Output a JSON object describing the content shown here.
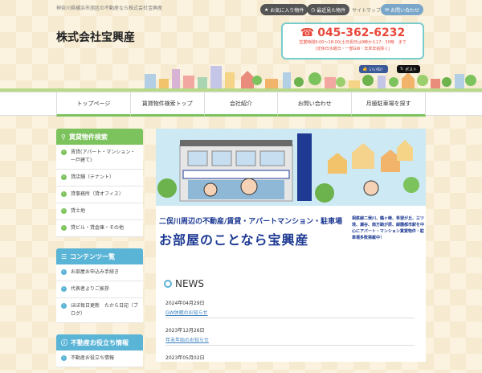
{
  "header": {
    "tagline": "神奈川県横浜市旭区の不動産なら株式会社宝興産",
    "favorites_label": "お気に入り物件",
    "recent_label": "最近見た物件",
    "sitemap_label": "サイトマップ",
    "contact_label": "お問い合わせ",
    "company_name": "株式会社宝興産",
    "phone": "045-362-6232",
    "hours_line1": "営業時間9:00～18:00(土日祝日は9時から17：30時　まで",
    "hours_line2": "(定休日水曜日・一部GW・年末年始除く)",
    "like_label": "いいね！",
    "post_label": "ポスト"
  },
  "nav": {
    "items": [
      "トップページ",
      "賃貸物件検索トップ",
      "会社紹介",
      "お問い合わせ",
      "月極駐車場を探す"
    ]
  },
  "sidebar": {
    "rental_heading": "賃貸物件検索",
    "rental_items": [
      "賃貸(アパート・マンション・一戸建て)",
      "貸店舗（テナント）",
      "貸事務所（貸オフィス）",
      "貸土地",
      "貸ビル・貸倉庫・その他"
    ],
    "contents_heading": "コンテンツ一覧",
    "contents_items": [
      "お部屋お申込み手続き",
      "代表者よりご挨拶",
      "ほぼ毎日更新　たから日記（ブログ）"
    ],
    "tips_heading": "不動産お役立ち情報",
    "tips_items": [
      "不動産お役立ち情報"
    ]
  },
  "hero": {
    "line1": "二俣川周辺の不動産/賃貸・アパートマンション・駐車場",
    "line2": "お部屋のことなら宝興産",
    "side_text": "相鉄線二俣川、鶴ヶ峰、希望が丘、三ツ境、瀬谷、南万騎が原、緑園都市駅を中心にアパート・マンション賃貸物件・駐車場多数掲載中！"
  },
  "news": {
    "title": "NEWS",
    "items": [
      {
        "date": "2024年04月29日",
        "title": "GW休暇のお知らせ"
      },
      {
        "date": "2023年12月26日",
        "title": "年末年始のお知らせ"
      },
      {
        "date": "2023年05月02日",
        "title": ""
      }
    ]
  },
  "colors": {
    "accent_green": "#7cc35d",
    "accent_blue": "#5ab4d6",
    "phone_red": "#e8483a",
    "hero_navy": "#1e3a93"
  }
}
